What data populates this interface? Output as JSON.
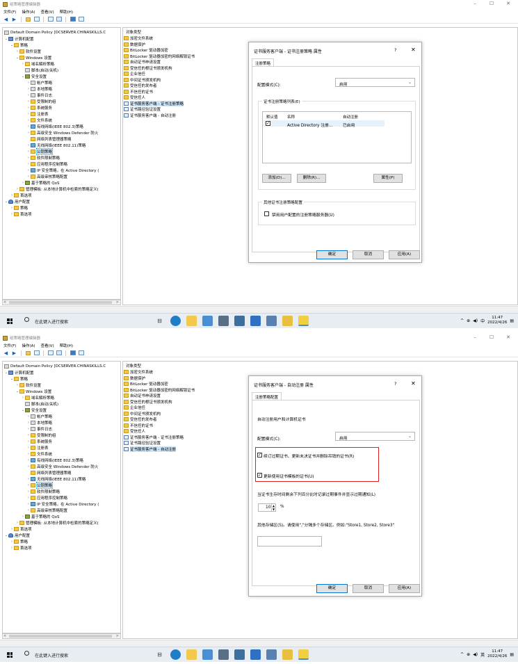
{
  "app": {
    "title": "组策略管理编辑器",
    "menus": [
      "文件(F)",
      "操作(A)",
      "查看(V)",
      "帮助(H)"
    ],
    "window_controls": {
      "min": "–",
      "max": "☐",
      "close": "✕"
    }
  },
  "tree": {
    "root": "Default Domain Policy [DCSERVER.CHINASKILLS.C",
    "items": [
      "计算机配置",
      "策略",
      "软件设置",
      "Windows 设置",
      "域名解析策略",
      "脚本(启动/关机)",
      "安全设置",
      "帐户策略",
      "本地策略",
      "事件日志",
      "受限制的组",
      "系统服务",
      "注册表",
      "文件系统",
      "有线网络(IEEE 802.3)策略",
      "高级安全 Windows Defender 防火",
      "网络列表管理器策略",
      "无线网络(IEEE 802.11)策略",
      "公钥策略",
      "软件限制策略",
      "应用程序控制策略",
      "IP 安全策略，在 Active Directory (",
      "高级审核策略配置",
      "基于策略的 QoS",
      "管理模板: 从本地计算机中检索的策略定义(",
      "首选项",
      "用户配置",
      "策略",
      "首选项"
    ]
  },
  "list": {
    "header": "对象类型",
    "items": [
      "加密文件系统",
      "数据保护",
      "BitLocker 驱动器加密",
      "BitLocker 驱动器加密的网络解锁证书",
      "自动证书申请设置",
      "受信任的根证书颁发机构",
      "企业信任",
      "中间证书颁发机构",
      "受信任的发布者",
      "不信任的证书",
      "受信任人",
      "证书服务客户端 - 证书注册策略",
      "证书路径验证设置",
      "证书服务客户端 - 自动注册"
    ]
  },
  "taskbar": {
    "search_placeholder": "在此键入进行搜索",
    "tray1": {
      "ime": "中",
      "time": "11:47",
      "date": "2022/4/26"
    },
    "tray2": {
      "ime": "英",
      "time": "11:47",
      "date": "2022/4/26"
    }
  },
  "dialog1": {
    "title": "证书服务客户端 - 证书注册策略 属性",
    "help": "?",
    "close": "✕",
    "tab": "注册策略",
    "config_label": "配置模式(C):",
    "config_value": "启用",
    "group_title": "证书注册策略列表(E)",
    "columns": [
      "默认值",
      "名称",
      "自动注册"
    ],
    "row": {
      "name": "Active Directory 注册...",
      "auto": "已启用",
      "checked": true
    },
    "add": "添加(D)...",
    "remove": "删除(R)...",
    "props": "属性(P)",
    "other_group": "其他证书注册策略配置",
    "disable_user": "禁用用户配置的注册策略服务器(U)",
    "ok": "确定",
    "cancel": "取消",
    "apply": "应用(A)"
  },
  "dialog2": {
    "title": "证书服务客户端 - 自动注册 属性",
    "help": "?",
    "close": "✕",
    "tab": "注册策略配置",
    "heading": "自动注册用户和计算机证书",
    "config_label": "配置模式(C):",
    "config_value": "启用",
    "renew": "续订过期证书、更新未决证书并删除吊销的证书(R)",
    "update": "更新使用证书模板的证书(U)",
    "notify": "当证书生存时间剩余下列百分比时记录过期事件并显示过期通知(L)",
    "percent": "10",
    "percent_unit": "%",
    "other_stores": "其他存储区(S)。请使用\",\"分隔多个存储区。例如:\"Store1, Store2, Store3\"",
    "ok": "确定",
    "cancel": "取消",
    "apply": "应用(A)"
  },
  "colors": {
    "accent": "#0078d7",
    "highlight": "#e02020"
  }
}
